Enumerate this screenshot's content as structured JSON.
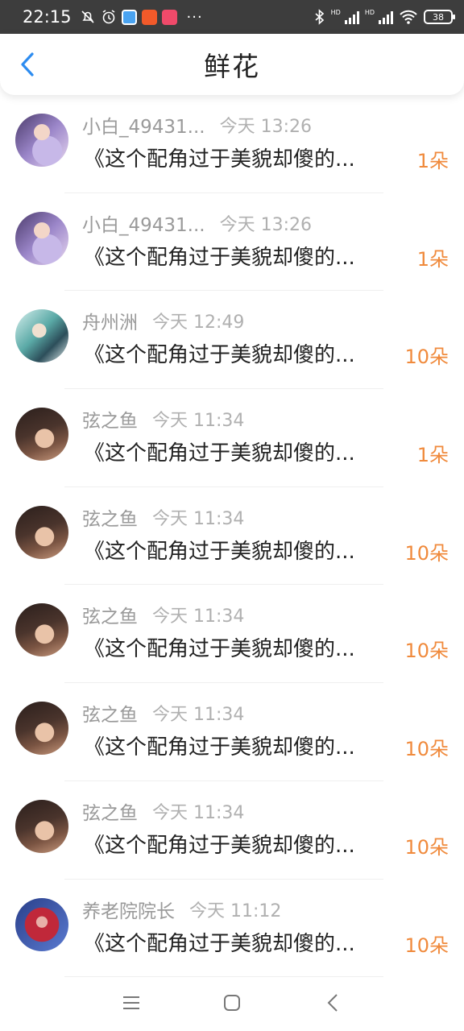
{
  "status_bar": {
    "time": "22:15",
    "battery": "38",
    "hd1": "HD",
    "hd2": "HD"
  },
  "header": {
    "title": "鲜花"
  },
  "colors": {
    "accent_blue": "#2d8cf0",
    "count_orange": "#f08a3c"
  },
  "rows": [
    {
      "user": "小白_49431...",
      "time": "今天 13:26",
      "message": "《这个配角过于美貌却傻的...",
      "count": "1朵",
      "avatar": "anime-girl-avatar"
    },
    {
      "user": "小白_49431...",
      "time": "今天 13:26",
      "message": "《这个配角过于美貌却傻的...",
      "count": "1朵",
      "avatar": "anime-girl-avatar"
    },
    {
      "user": "舟州洲",
      "time": "今天 12:49",
      "message": "《这个配角过于美貌却傻的...",
      "count": "10朵",
      "avatar": "anime-character-avatar"
    },
    {
      "user": "弦之鱼",
      "time": "今天 11:34",
      "message": "《这个配角过于美貌却傻的...",
      "count": "1朵",
      "avatar": "dark-hair-girl-avatar"
    },
    {
      "user": "弦之鱼",
      "time": "今天 11:34",
      "message": "《这个配角过于美貌却傻的...",
      "count": "10朵",
      "avatar": "dark-hair-girl-avatar"
    },
    {
      "user": "弦之鱼",
      "time": "今天 11:34",
      "message": "《这个配角过于美貌却傻的...",
      "count": "10朵",
      "avatar": "dark-hair-girl-avatar"
    },
    {
      "user": "弦之鱼",
      "time": "今天 11:34",
      "message": "《这个配角过于美貌却傻的...",
      "count": "10朵",
      "avatar": "dark-hair-girl-avatar"
    },
    {
      "user": "弦之鱼",
      "time": "今天 11:34",
      "message": "《这个配角过于美貌却傻的...",
      "count": "10朵",
      "avatar": "dark-hair-girl-avatar"
    },
    {
      "user": "养老院院长",
      "time": "今天 11:12",
      "message": "《这个配角过于美貌却傻的...",
      "count": "10朵",
      "avatar": "red-hair-character-avatar"
    }
  ]
}
